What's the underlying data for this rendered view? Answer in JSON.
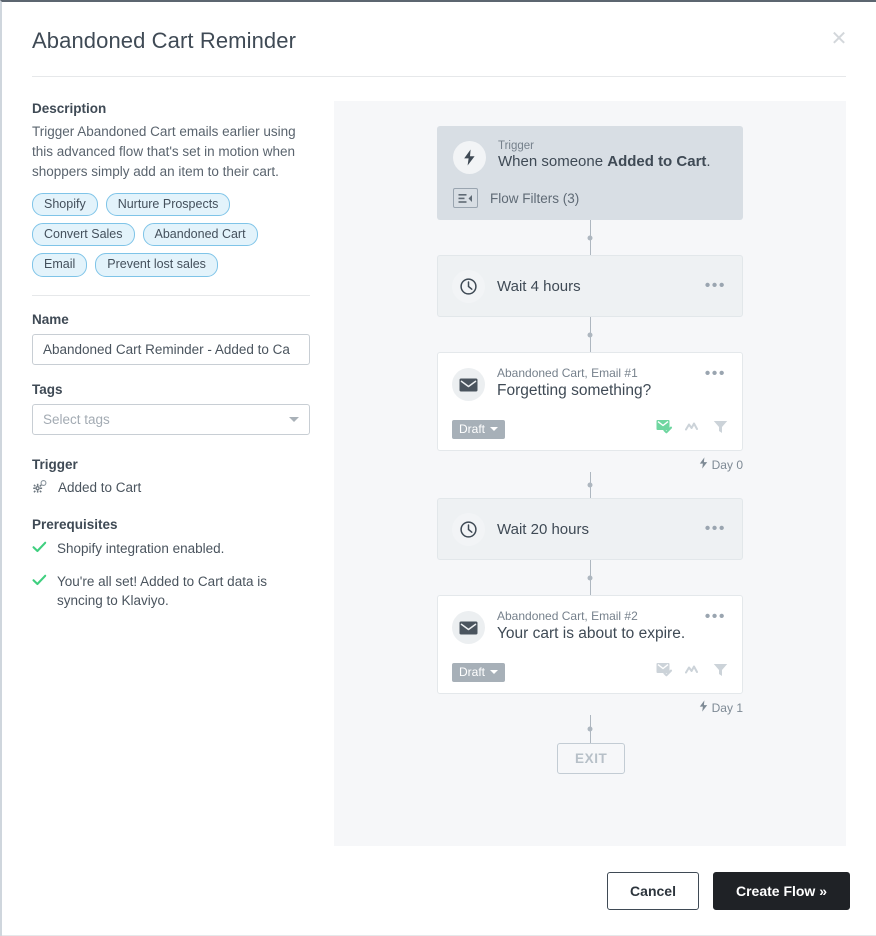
{
  "header": {
    "title": "Abandoned Cart Reminder",
    "close_icon": "close-icon"
  },
  "sidebar": {
    "description_label": "Description",
    "description_text": "Trigger Abandoned Cart emails earlier using this advanced flow that's set in motion when shoppers simply add an item to their cart.",
    "tags": [
      "Shopify",
      "Nurture Prospects",
      "Convert Sales",
      "Abandoned Cart",
      "Email",
      "Prevent lost sales"
    ],
    "name_label": "Name",
    "name_value": "Abandoned Cart Reminder - Added to Ca",
    "tags_label": "Tags",
    "tags_placeholder": "Select tags",
    "trigger_label": "Trigger",
    "trigger_value": "Added to Cart",
    "trigger_icon": "gears-icon",
    "prerequisites_label": "Prerequisites",
    "prerequisites": [
      "Shopify integration enabled.",
      "You're all set! Added to Cart data is syncing to Klaviyo."
    ]
  },
  "flow": {
    "trigger_node": {
      "kicker": "Trigger",
      "title_prefix": "When someone ",
      "title_strong": "Added to Cart",
      "title_suffix": ".",
      "icon": "lightning-bolt-icon",
      "filters_label": "Flow Filters (3)",
      "filters_icon": "flow-filter-icon"
    },
    "wait_1": {
      "label": "Wait 4 hours",
      "icon": "clock-icon",
      "menu": "•••"
    },
    "email_1": {
      "kicker": "Abandoned Cart, Email #1",
      "subject": "Forgetting something?",
      "icon": "envelope-icon",
      "status": "Draft",
      "menu": "•••",
      "day_label": "Day 0",
      "actions": [
        {
          "name": "smart-sending-icon",
          "active": true
        },
        {
          "name": "conversion-tracking-icon",
          "active": false
        },
        {
          "name": "flow-filter-funnel-icon",
          "active": false
        }
      ]
    },
    "wait_2": {
      "label": "Wait 20 hours",
      "icon": "clock-icon",
      "menu": "•••"
    },
    "email_2": {
      "kicker": "Abandoned Cart, Email #2",
      "subject": "Your cart is about to expire.",
      "icon": "envelope-icon",
      "status": "Draft",
      "menu": "•••",
      "day_label": "Day 1",
      "actions": [
        {
          "name": "smart-sending-icon",
          "active": false
        },
        {
          "name": "conversion-tracking-icon",
          "active": false
        },
        {
          "name": "flow-filter-funnel-icon",
          "active": false
        }
      ]
    },
    "exit_label": "EXIT"
  },
  "footer": {
    "cancel_label": "Cancel",
    "create_label": "Create Flow »"
  },
  "colors": {
    "accent_green": "#6fd6a0",
    "tag_border": "#7fc4e8",
    "tag_fill": "#e3f3fb",
    "primary_button": "#1f2226",
    "canvas": "#f6f7f9",
    "trigger_node": "#d8dee4",
    "wait_node": "#eef1f3"
  }
}
